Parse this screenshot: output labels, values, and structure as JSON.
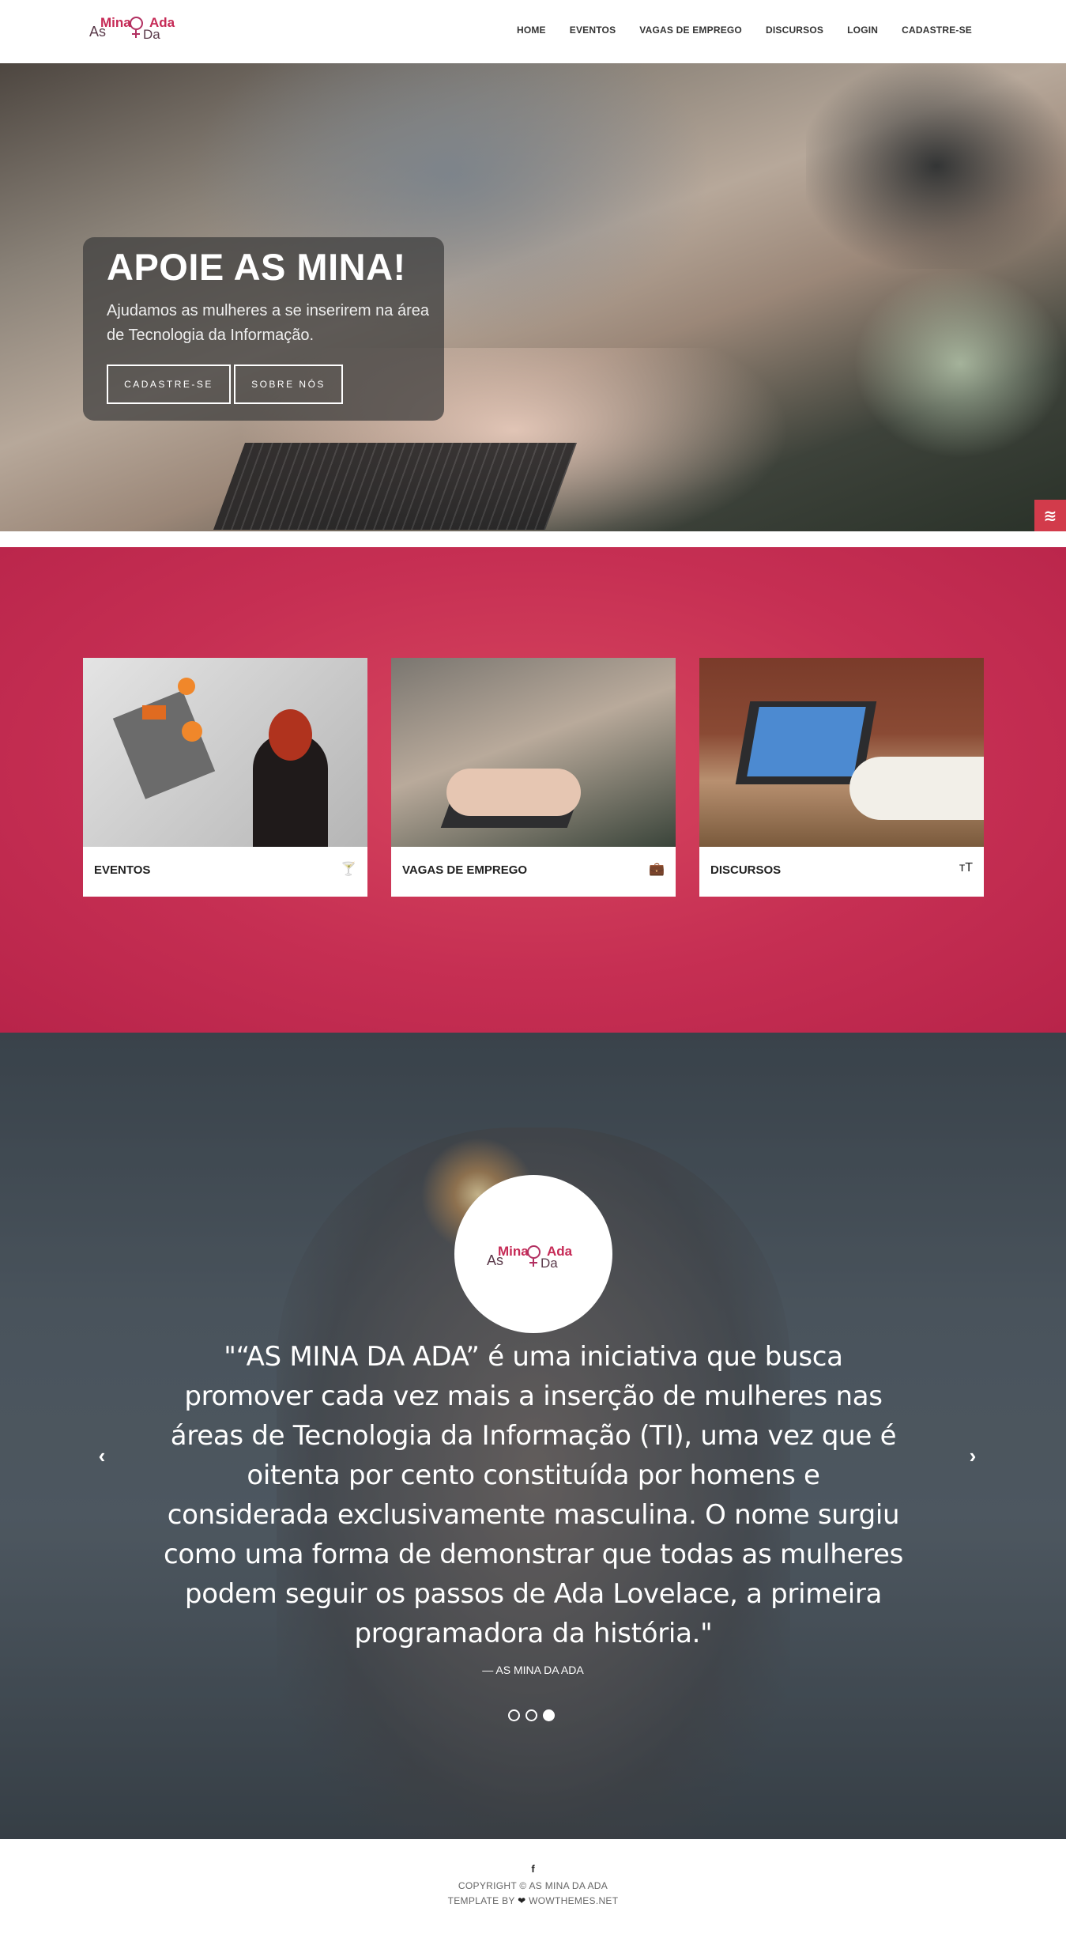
{
  "nav": {
    "logo": {
      "as": "As",
      "mina": "Mina",
      "ada": "Ada",
      "da": "Da"
    },
    "items": [
      "HOME",
      "EVENTOS",
      "VAGAS DE EMPREGO",
      "DISCURSOS",
      "LOGIN",
      "CADASTRE-SE"
    ]
  },
  "hero": {
    "title": "APOIE AS MINA!",
    "subtitle": "Ajudamos as mulheres a se inserirem na área de Tecnologia da Informação.",
    "btn_register": "CADASTRE-SE",
    "btn_about": "SOBRE NÓS"
  },
  "features": {
    "cards": [
      {
        "label": "EVENTOS",
        "icon": "cocktail-glass-icon",
        "glyph": "🍸"
      },
      {
        "label": "VAGAS DE EMPREGO",
        "icon": "briefcase-icon",
        "glyph": "💼"
      },
      {
        "label": "DISCURSOS",
        "icon": "text-size-icon",
        "glyph": "ᴛT"
      }
    ]
  },
  "testimonial": {
    "quote": "\"“AS MINA DA ADA” é uma iniciativa que busca promover cada vez mais a inserção de mulheres nas áreas de Tecnologia da Informação (TI), uma vez que é oitenta por cento constituída por homens e considerada exclusivamente masculina. O nome surgiu como uma forma de demonstrar que todas as mulheres podem seguir os passos de Ada Lovelace, a primeira programadora da história.\"",
    "author": "— AS MINA DA ADA",
    "prev": "‹",
    "next": "›",
    "active_slide": 3,
    "slide_count": 3
  },
  "footer": {
    "social": "f",
    "copyright": "COPYRIGHT © AS MINA DA ADA",
    "template_prefix": "TEMPLATE BY",
    "template_suffix": "WOWTHEMES.NET"
  },
  "colors": {
    "accent": "#c62f53",
    "brand": "#c62a56",
    "badge": "#d23b4b"
  }
}
